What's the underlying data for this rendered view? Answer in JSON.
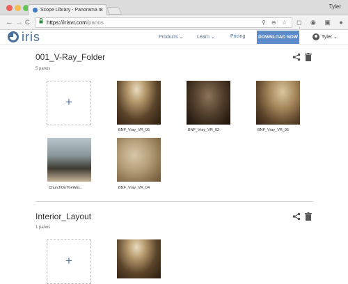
{
  "browser": {
    "tab_title": "Scope Library - Panorama m",
    "tab_close": "×",
    "profile_name": "Tyler",
    "nav_back": "←",
    "nav_forward": "→",
    "nav_reload": "C",
    "secure_icon": "lock-icon",
    "url_host": "https://irisvr.com",
    "url_path": "/panos",
    "omnibox_icons": "⚲ ⊖ ☆",
    "extension_icons": "◻ ◉ ▣ ● ⋮"
  },
  "header": {
    "logo_text": "iris",
    "nav": [
      {
        "label": "Products ⌄"
      },
      {
        "label": "Learn ⌄"
      },
      {
        "label": "Pricing"
      }
    ],
    "download_label": "DOWNLOAD NOW",
    "user_label": "Tyler ⌄"
  },
  "folders": [
    {
      "title": "001_V-Ray_Folder",
      "count": "5 panos",
      "add_label": "+",
      "items": [
        {
          "label": "BNF_Vray_VR_06"
        },
        {
          "label": "BNF_Vray_VR_02"
        },
        {
          "label": "BNF_Vray_VR_05"
        },
        {
          "label": "ChurchOnTheWat..."
        },
        {
          "label": "BNF_Vray_VR_04"
        }
      ]
    },
    {
      "title": "Interior_Layout",
      "count": "1 panos",
      "add_label": "+"
    }
  ],
  "icons": {
    "share": "share-icon",
    "delete": "trash-icon"
  },
  "colors": {
    "brand": "#4a6f9c",
    "download_button": "#5b8bc9"
  }
}
